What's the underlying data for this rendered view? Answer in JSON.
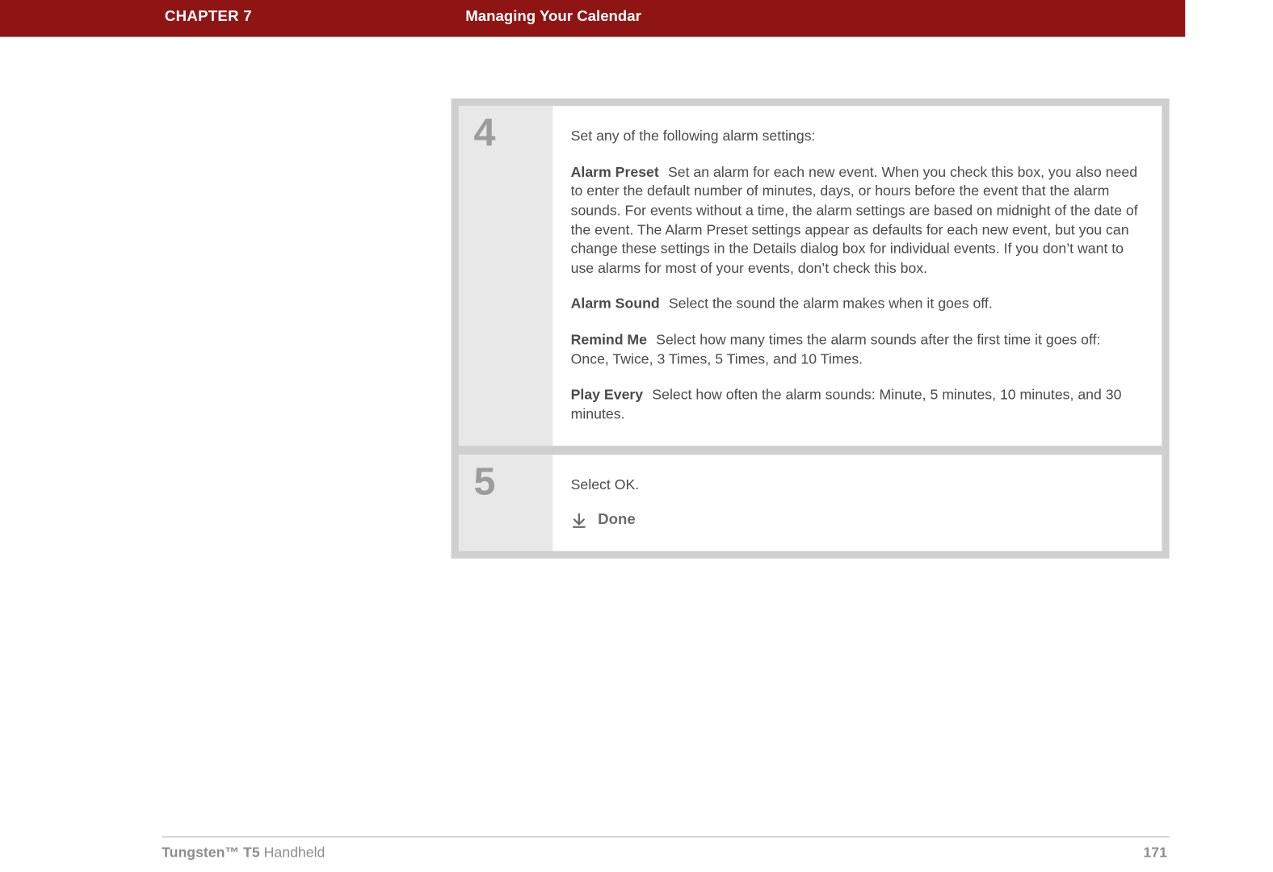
{
  "header": {
    "chapter_label": "CHAPTER 7",
    "chapter_title": "Managing Your Calendar"
  },
  "steps": [
    {
      "number": "4",
      "intro": "Set any of the following alarm settings:",
      "settings": [
        {
          "label": "Alarm Preset",
          "text": "Set an alarm for each new event. When you check this box, you also need to enter the default number of minutes, days, or hours before the event that the alarm sounds. For events without a time, the alarm settings are based on midnight of the date of the event. The Alarm Preset settings appear as defaults for each new event, but you can change these settings in the Details dialog box for individual events. If you don’t want to use alarms for most of your events, don’t check this box."
        },
        {
          "label": "Alarm Sound",
          "text": "Select the sound the alarm makes when it goes off."
        },
        {
          "label": "Remind Me",
          "text": "Select how many times the alarm sounds after the first time it goes off: Once, Twice, 3 Times, 5 Times, and 10 Times."
        },
        {
          "label": "Play Every",
          "text": "Select how often the alarm sounds: Minute, 5 minutes, 10 minutes, and 30 minutes."
        }
      ]
    },
    {
      "number": "5",
      "intro": "Select OK.",
      "done_label": "Done"
    }
  ],
  "footer": {
    "product_strong": "Tungsten™ T5",
    "product_rest": " Handheld",
    "page_number": "171"
  }
}
